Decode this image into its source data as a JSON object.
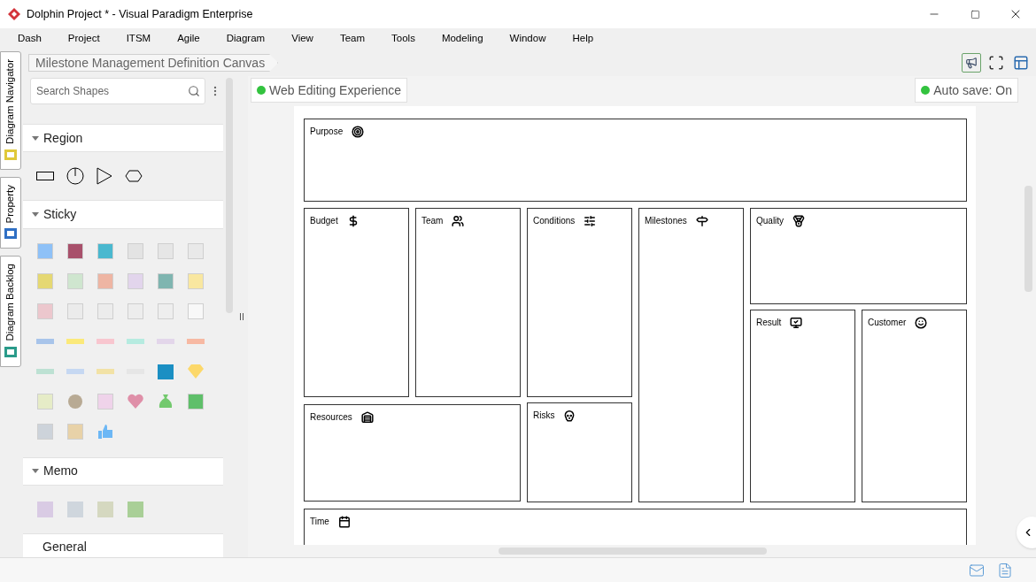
{
  "window": {
    "title": "Dolphin Project * - Visual Paradigm Enterprise"
  },
  "menu": [
    "Dash",
    "Project",
    "ITSM",
    "Agile",
    "Diagram",
    "View",
    "Team",
    "Tools",
    "Modeling",
    "Window",
    "Help"
  ],
  "side_tabs": [
    "Diagram Navigator",
    "Property",
    "Diagram Backlog"
  ],
  "breadcrumb": "Milestone Management Definition Canvas",
  "palette": {
    "search": {
      "placeholder": "Search Shapes"
    },
    "sections": [
      {
        "title": "Region"
      },
      {
        "title": "Sticky"
      },
      {
        "title": "Memo"
      },
      {
        "title": "General"
      }
    ]
  },
  "canvas": {
    "web_editing": "Web Editing Experience",
    "auto_save": "Auto save: On",
    "blocks": [
      {
        "label": "Purpose"
      },
      {
        "label": "Budget"
      },
      {
        "label": "Team"
      },
      {
        "label": "Conditions"
      },
      {
        "label": "Milestones"
      },
      {
        "label": "Quality"
      },
      {
        "label": "Result"
      },
      {
        "label": "Customer"
      },
      {
        "label": "Resources"
      },
      {
        "label": "Risks"
      },
      {
        "label": "Time"
      }
    ]
  }
}
